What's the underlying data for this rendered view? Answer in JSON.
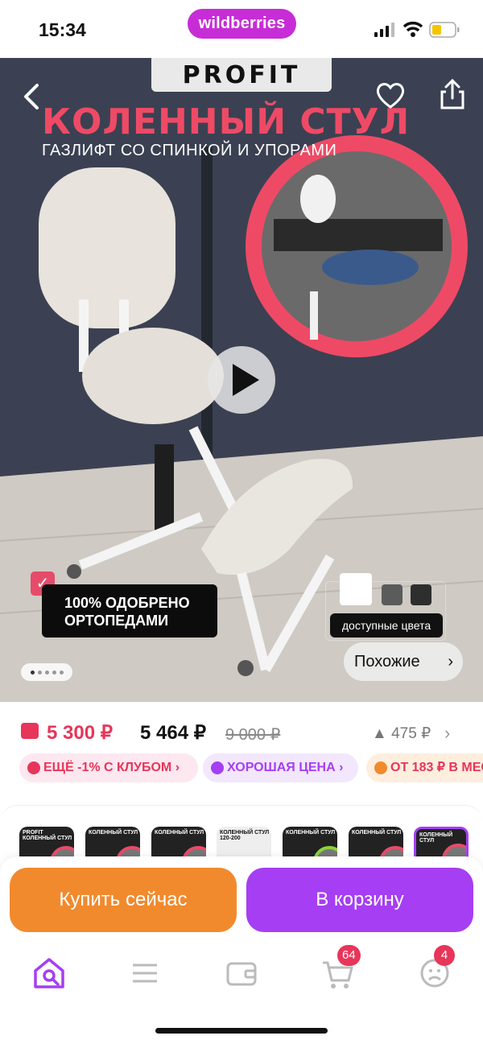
{
  "status_bar": {
    "time": "15:34",
    "app_pill": "wildberries"
  },
  "hero": {
    "brand_logo": "PROFIT",
    "title": "КОЛЕННЫЙ СТУЛ",
    "subtitle": "ГАЗЛИФТ СО СПИНКОЙ И УПОРАМИ",
    "approved_text": "100% ОДОБРЕНО ОРТОПЕДАМИ",
    "colors_label": "доступные цвета",
    "similar_button": "Похожие",
    "color_swatches": [
      "#ffffff",
      "#5b5b5b",
      "#2e2e2e"
    ]
  },
  "price": {
    "wallet_price": "5 300 ₽",
    "price": "5 464 ₽",
    "old_price": "9 000 ₽",
    "trend": "475 ₽"
  },
  "chips": [
    {
      "label": "ЕЩЁ -1% С КЛУБОМ",
      "color": "#e8355a",
      "bg": "#fde8f0"
    },
    {
      "label": "ХОРОШАЯ ЦЕНА",
      "color": "#a63ef3",
      "bg": "#f2e7fd"
    },
    {
      "label": "ОТ 183 ₽ В МЕС",
      "color": "#e8355a",
      "bg": "#fdeede"
    }
  ],
  "thumbnails": [
    "PROFIT КОЛЕННЫЙ СТУЛ",
    "КОЛЕННЫЙ СТУЛ",
    "КОЛЕННЫЙ СТУЛ",
    "КОЛЕННЫЙ СТУЛ 120-200",
    "КОЛЕННЫЙ СТУЛ",
    "КОЛЕННЫЙ СТУЛ",
    "КОЛЕННЫЙ СТУЛ"
  ],
  "actions": {
    "buy_now": "Купить сейчас",
    "add_to_cart": "В корзину"
  },
  "bottom_nav": {
    "items": [
      "home-search-icon",
      "menu-icon",
      "wallet-icon",
      "cart-icon",
      "profile-icon"
    ],
    "cart_badge": "64",
    "profile_badge": "4"
  }
}
